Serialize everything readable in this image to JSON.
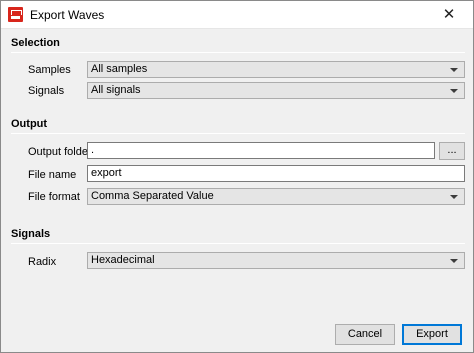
{
  "window": {
    "title": "Export Waves",
    "close_glyph": "✕",
    "app_icon": "app-logo-icon"
  },
  "selection": {
    "heading": "Selection",
    "samples_label": "Samples",
    "samples_value": "All samples",
    "signals_label": "Signals",
    "signals_value": "All signals"
  },
  "output": {
    "heading": "Output",
    "folder_label": "Output folder",
    "folder_value": ".",
    "browse_label": "...",
    "file_name_label": "File name",
    "file_name_value": "export",
    "file_format_label": "File format",
    "file_format_value": "Comma Separated Value"
  },
  "signals": {
    "heading": "Signals",
    "radix_label": "Radix",
    "radix_value": "Hexadecimal"
  },
  "buttons": {
    "cancel": "Cancel",
    "export": "Export"
  },
  "colors": {
    "accent": "#0078d7",
    "icon": "#d8261c"
  }
}
